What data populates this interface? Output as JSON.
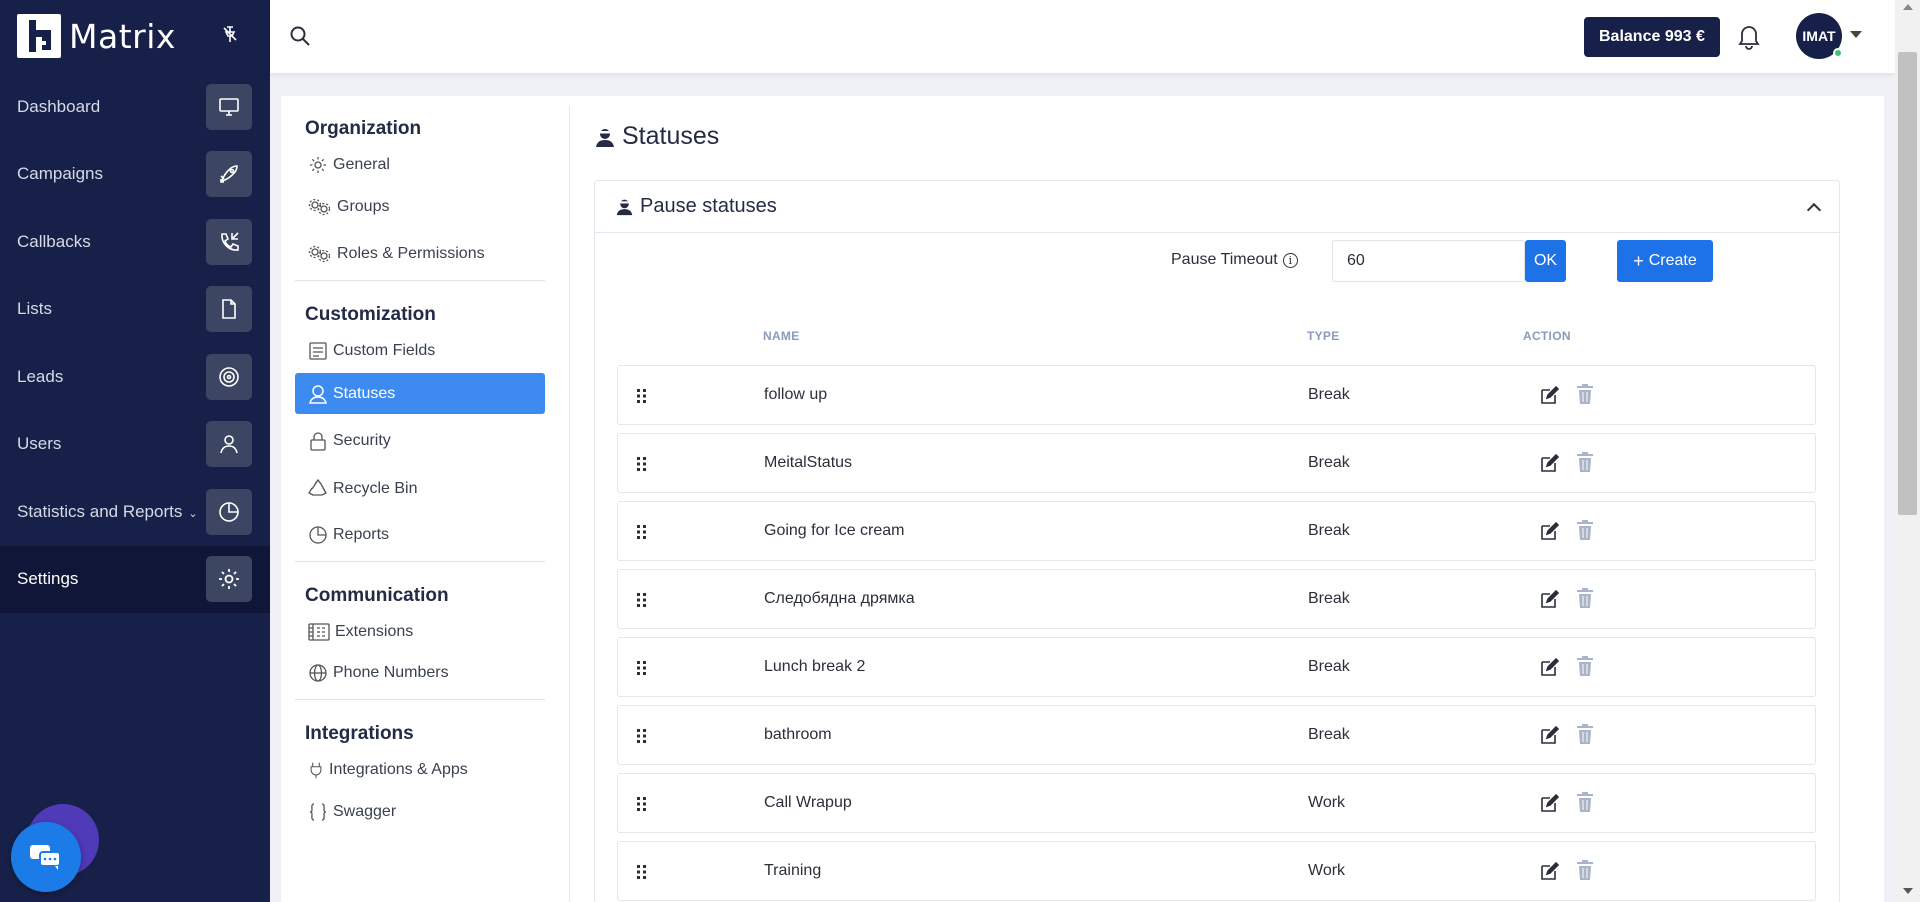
{
  "app": {
    "name": "Matrix"
  },
  "nav": [
    {
      "label": "Dashboard",
      "icon": "monitor-icon"
    },
    {
      "label": "Campaigns",
      "icon": "rocket-icon"
    },
    {
      "label": "Callbacks",
      "icon": "phone-callback-icon"
    },
    {
      "label": "Lists",
      "icon": "document-icon"
    },
    {
      "label": "Leads",
      "icon": "target-icon"
    },
    {
      "label": "Users",
      "icon": "user-icon"
    },
    {
      "label": "Statistics and Reports",
      "icon": "pie-chart-icon"
    },
    {
      "label": "Settings",
      "icon": "gear-icon"
    }
  ],
  "topbar": {
    "balance": "Balance 993 €",
    "avatar": "IMAT"
  },
  "settings_menu": {
    "organization": {
      "title": "Organization",
      "general": "General",
      "groups": "Groups",
      "roles": "Roles & Permissions"
    },
    "customization": {
      "title": "Customization",
      "custom_fields": "Custom Fields",
      "statuses": "Statuses",
      "security": "Security",
      "recycle_bin": "Recycle Bin",
      "reports": "Reports"
    },
    "communication": {
      "title": "Communication",
      "extensions": "Extensions",
      "phone_numbers": "Phone Numbers"
    },
    "integrations": {
      "title": "Integrations",
      "apps": "Integrations & Apps",
      "swagger": "Swagger"
    }
  },
  "page": {
    "title": "Statuses",
    "card_title": "Pause statuses",
    "timeout_label": "Pause Timeout",
    "timeout_value": "60",
    "ok_label": "OK",
    "create_label": "Create"
  },
  "table": {
    "headers": {
      "name": "NAME",
      "type": "TYPE",
      "action": "ACTION"
    },
    "rows": [
      {
        "name": "follow up",
        "type": "Break"
      },
      {
        "name": "MeitalStatus",
        "type": "Break"
      },
      {
        "name": "Going for Ice cream",
        "type": "Break"
      },
      {
        "name": "Следобядна дрямка",
        "type": "Break"
      },
      {
        "name": "Lunch break 2",
        "type": "Break"
      },
      {
        "name": "bathroom",
        "type": "Break"
      },
      {
        "name": "Call Wrapup",
        "type": "Work"
      },
      {
        "name": "Training",
        "type": "Work"
      }
    ]
  },
  "colors": {
    "sidebar": "#172048",
    "accent": "#1e72e8",
    "active_menu": "#3d8bf0"
  }
}
